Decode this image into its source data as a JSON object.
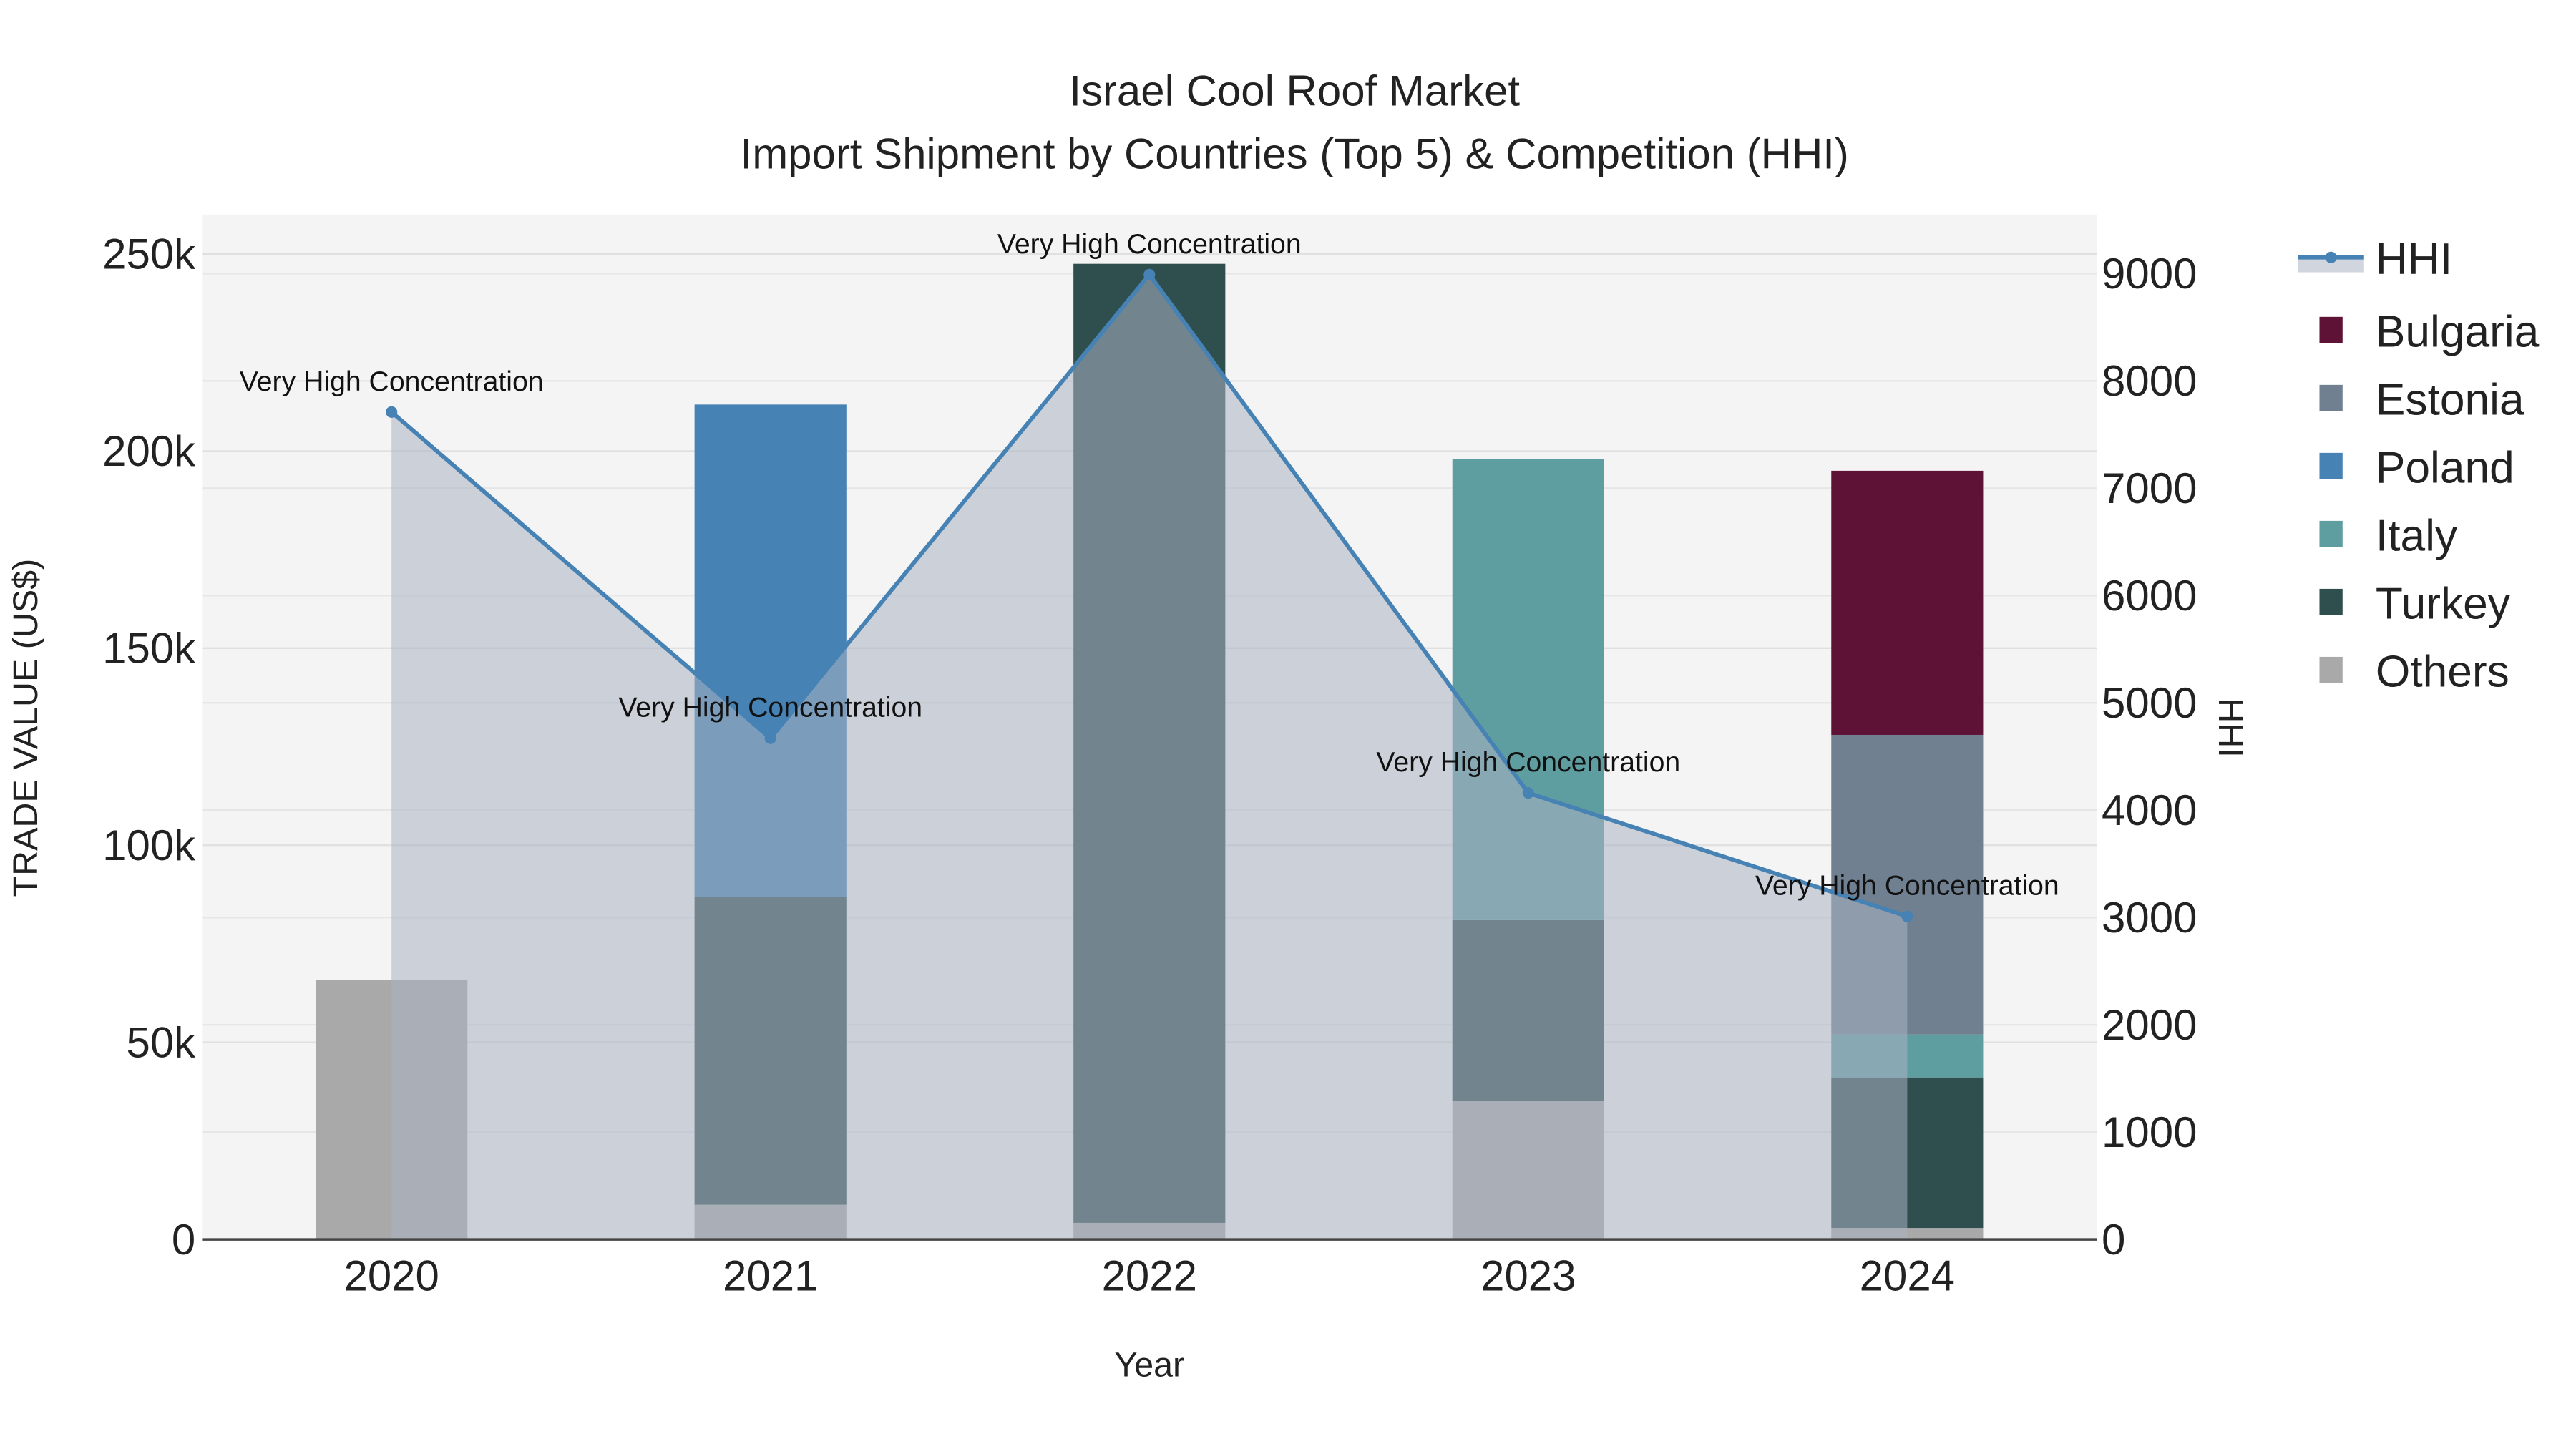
{
  "chart_data": {
    "type": "bar",
    "title": "Israel Cool Roof Market",
    "subtitle": "Import Shipment by Countries (Top 5) & Competition (HHI)",
    "xlabel": "Year",
    "ylabel": "TRADE VALUE (US$)",
    "y2label": "HHI",
    "categories": [
      "2020",
      "2021",
      "2022",
      "2023",
      "2024"
    ],
    "ylim": [
      0,
      260000
    ],
    "y2lim": [
      0,
      9550
    ],
    "yticks": [
      0,
      50000,
      100000,
      150000,
      200000,
      250000
    ],
    "ytick_labels": [
      "0",
      "50k",
      "100k",
      "150k",
      "200k",
      "250k"
    ],
    "y2ticks": [
      0,
      1000,
      2000,
      3000,
      4000,
      5000,
      6000,
      7000,
      8000,
      9000
    ],
    "y2tick_labels": [
      "0",
      "1000",
      "2000",
      "3000",
      "4000",
      "5000",
      "6000",
      "7000",
      "8000",
      "9000"
    ],
    "grid": true,
    "legend_position": "right",
    "stack_order": [
      "Others",
      "Turkey",
      "Italy",
      "Estonia",
      "Poland",
      "Bulgaria"
    ],
    "series": [
      {
        "name": "Bulgaria",
        "color": "#5e1336",
        "values": [
          0,
          0,
          0,
          0,
          67000
        ]
      },
      {
        "name": "Estonia",
        "color": "#708090",
        "values": [
          0,
          0,
          0,
          0,
          76000
        ]
      },
      {
        "name": "Poland",
        "color": "#4682b4",
        "values": [
          0,
          125000,
          0,
          0,
          0
        ]
      },
      {
        "name": "Italy",
        "color": "#5f9ea0",
        "values": [
          0,
          0,
          0,
          117000,
          10900
        ]
      },
      {
        "name": "Turkey",
        "color": "#2f4f4f",
        "values": [
          0,
          78000,
          243300,
          45800,
          38200
        ]
      },
      {
        "name": "Others",
        "color": "#a9a9a9",
        "values": [
          65900,
          8800,
          4200,
          35200,
          2900
        ]
      }
    ],
    "hhi": {
      "name": "HHI",
      "color": "#4682b4",
      "values": [
        7710,
        4670,
        8990,
        4160,
        3010
      ],
      "annotations": [
        "Very High Concentration",
        "Very High Concentration",
        "Very High Concentration",
        "Very High Concentration",
        "Very High Concentration"
      ]
    }
  }
}
